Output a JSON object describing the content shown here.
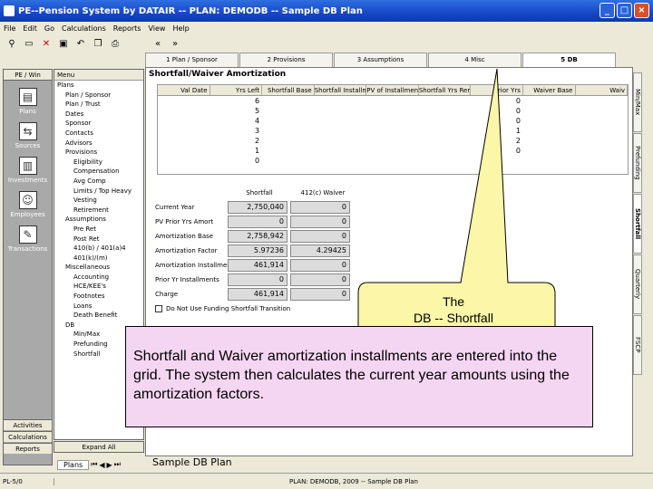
{
  "window": {
    "title": "PE--Pension System by DATAIR -- PLAN: DEMODB -- Sample DB Plan"
  },
  "menu": [
    "File",
    "Edit",
    "Go",
    "Calculations",
    "Reports",
    "View",
    "Help"
  ],
  "nav": {
    "back": "«",
    "forward": "»"
  },
  "tabs": [
    "1 Plan / Sponsor",
    "2 Provisions",
    "3 Assumptions",
    "4 Misc",
    "5 DB"
  ],
  "outbar": {
    "header": "PE / Win",
    "items": [
      "Plans",
      "Sources",
      "Investments",
      "Employees",
      "Transactions"
    ],
    "footer": [
      "Activities",
      "Calculations",
      "Reports"
    ]
  },
  "tree": {
    "header": "Menu",
    "items": [
      "Plans",
      "Plan / Sponsor",
      "Plan / Trust",
      "Dates",
      "Sponsor",
      "Contacts",
      "Advisors",
      "Provisions",
      "Eligibility",
      "Compensation",
      "Avg Comp",
      "Limits / Top Heavy",
      "Vesting",
      "Retirement",
      "Assumptions",
      "Pre Ret",
      "Post Ret",
      "410(b) / 401(a)4",
      "401(k)/(m)",
      "Miscellaneous",
      "Accounting",
      "HCE/KEE's",
      "Footnotes",
      "Loans",
      "Death Benefit",
      "DB",
      "Min/Max",
      "Prefunding",
      "Shortfall"
    ],
    "expand_all": "Expand All"
  },
  "section": {
    "title": "Shortfall/Waiver Amortization"
  },
  "grid": {
    "columns": [
      "Val Date",
      "Yrs Left",
      "Shortfall Base",
      "Shortfall Installment",
      "PV of Installments",
      "Shortfall Yrs Rem",
      "Prior Yrs",
      "Waiver Base",
      "Waiv"
    ],
    "rows": [
      {
        "yrs_left": "6",
        "prior_yrs": "0"
      },
      {
        "yrs_left": "5",
        "prior_yrs": "0"
      },
      {
        "yrs_left": "4",
        "prior_yrs": "0"
      },
      {
        "yrs_left": "3",
        "prior_yrs": "1"
      },
      {
        "yrs_left": "2",
        "prior_yrs": "2"
      },
      {
        "yrs_left": "1",
        "prior_yrs": "0"
      },
      {
        "yrs_left": "0",
        "prior_yrs": ""
      }
    ]
  },
  "calc": {
    "col_headers": [
      "Shortfall",
      "412(c) Waiver"
    ],
    "rows": [
      {
        "label": "Current Year",
        "shortfall": "2,750,040",
        "waiver": "0"
      },
      {
        "label": "PV Prior Yrs Amort",
        "shortfall": "0",
        "waiver": "0"
      },
      {
        "label": "Amortization Base",
        "shortfall": "2,758,942",
        "waiver": "0"
      },
      {
        "label": "Amortization Factor",
        "shortfall": "5.97236",
        "waiver": "4.29425"
      },
      {
        "label": "Amortization Installment",
        "shortfall": "461,914",
        "waiver": "0"
      },
      {
        "label": "Prior Yr Installments",
        "shortfall": "0",
        "waiver": "0"
      },
      {
        "label": "Charge",
        "shortfall": "461,914",
        "waiver": "0"
      }
    ],
    "checkbox_label": "Do Not Use Funding Shortfall Transition"
  },
  "vtabs": [
    "Min/Max",
    "Prefunding",
    "Shortfall",
    "Quarterly",
    "FSCP"
  ],
  "bottom": {
    "tab": "Plans",
    "plan_name": "Sample DB Plan"
  },
  "status": {
    "left": "PL-5/0",
    "center": "PLAN: DEMODB, 2009 -- Sample DB Plan"
  },
  "callouts": {
    "small_line1": "The",
    "small_line2": "DB -- Shortfall",
    "main": "Shortfall and Waiver amortization installments are entered into the grid.  The system then calculates the current year amounts using the amortization factors."
  }
}
